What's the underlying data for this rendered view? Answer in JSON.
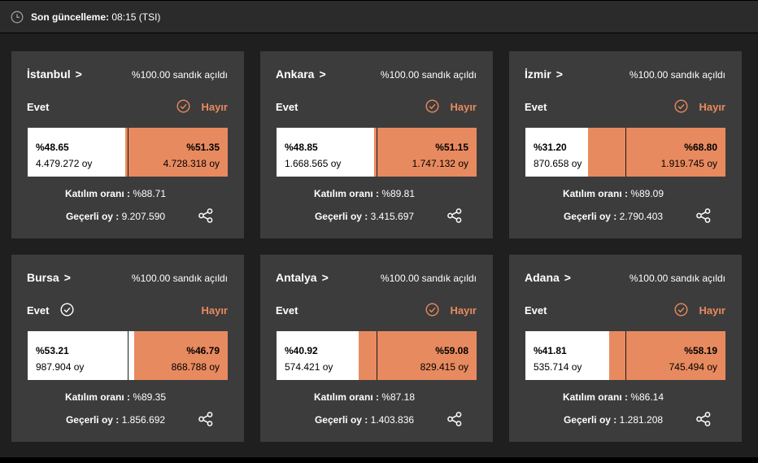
{
  "header": {
    "updated_label": "Son güncelleme:",
    "updated_time": "08:15 (TSI)",
    "icon": "clock-icon"
  },
  "labels": {
    "yes": "Evet",
    "no": "Hayır",
    "turnout": "Katılım oranı :",
    "valid": "Geçerli oy :",
    "arrow": ">"
  },
  "colors": {
    "background": "#1f1f1f",
    "card": "#3c3c3c",
    "no_color": "#e88a5f",
    "yes_color": "#ffffff"
  },
  "cards": [
    {
      "city": "İstanbul",
      "counted": "%100.00 sandık açıldı",
      "winner": "no",
      "yes_pct": "%48.65",
      "yes_votes": "4.479.272 oy",
      "no_pct": "%51.35",
      "no_votes": "4.728.318 oy",
      "yes_share": 48.65,
      "turnout": "%88.71",
      "valid": "9.207.590"
    },
    {
      "city": "Ankara",
      "counted": "%100.00 sandık açıldı",
      "winner": "no",
      "yes_pct": "%48.85",
      "yes_votes": "1.668.565 oy",
      "no_pct": "%51.15",
      "no_votes": "1.747.132 oy",
      "yes_share": 48.85,
      "turnout": "%89.81",
      "valid": "3.415.697"
    },
    {
      "city": "İzmir",
      "counted": "%100.00 sandık açıldı",
      "winner": "no",
      "yes_pct": "%31.20",
      "yes_votes": "870.658 oy",
      "no_pct": "%68.80",
      "no_votes": "1.919.745 oy",
      "yes_share": 31.2,
      "turnout": "%89.09",
      "valid": "2.790.403"
    },
    {
      "city": "Bursa",
      "counted": "%100.00 sandık açıldı",
      "winner": "yes",
      "yes_pct": "%53.21",
      "yes_votes": "987.904 oy",
      "no_pct": "%46.79",
      "no_votes": "868.788 oy",
      "yes_share": 53.21,
      "turnout": "%89.35",
      "valid": "1.856.692"
    },
    {
      "city": "Antalya",
      "counted": "%100.00 sandık açıldı",
      "winner": "no",
      "yes_pct": "%40.92",
      "yes_votes": "574.421 oy",
      "no_pct": "%59.08",
      "no_votes": "829.415 oy",
      "yes_share": 40.92,
      "turnout": "%87.18",
      "valid": "1.403.836"
    },
    {
      "city": "Adana",
      "counted": "%100.00 sandık açıldı",
      "winner": "no",
      "yes_pct": "%41.81",
      "yes_votes": "535.714 oy",
      "no_pct": "%58.19",
      "no_votes": "745.494 oy",
      "yes_share": 41.81,
      "turnout": "%86.14",
      "valid": "1.281.208"
    }
  ]
}
